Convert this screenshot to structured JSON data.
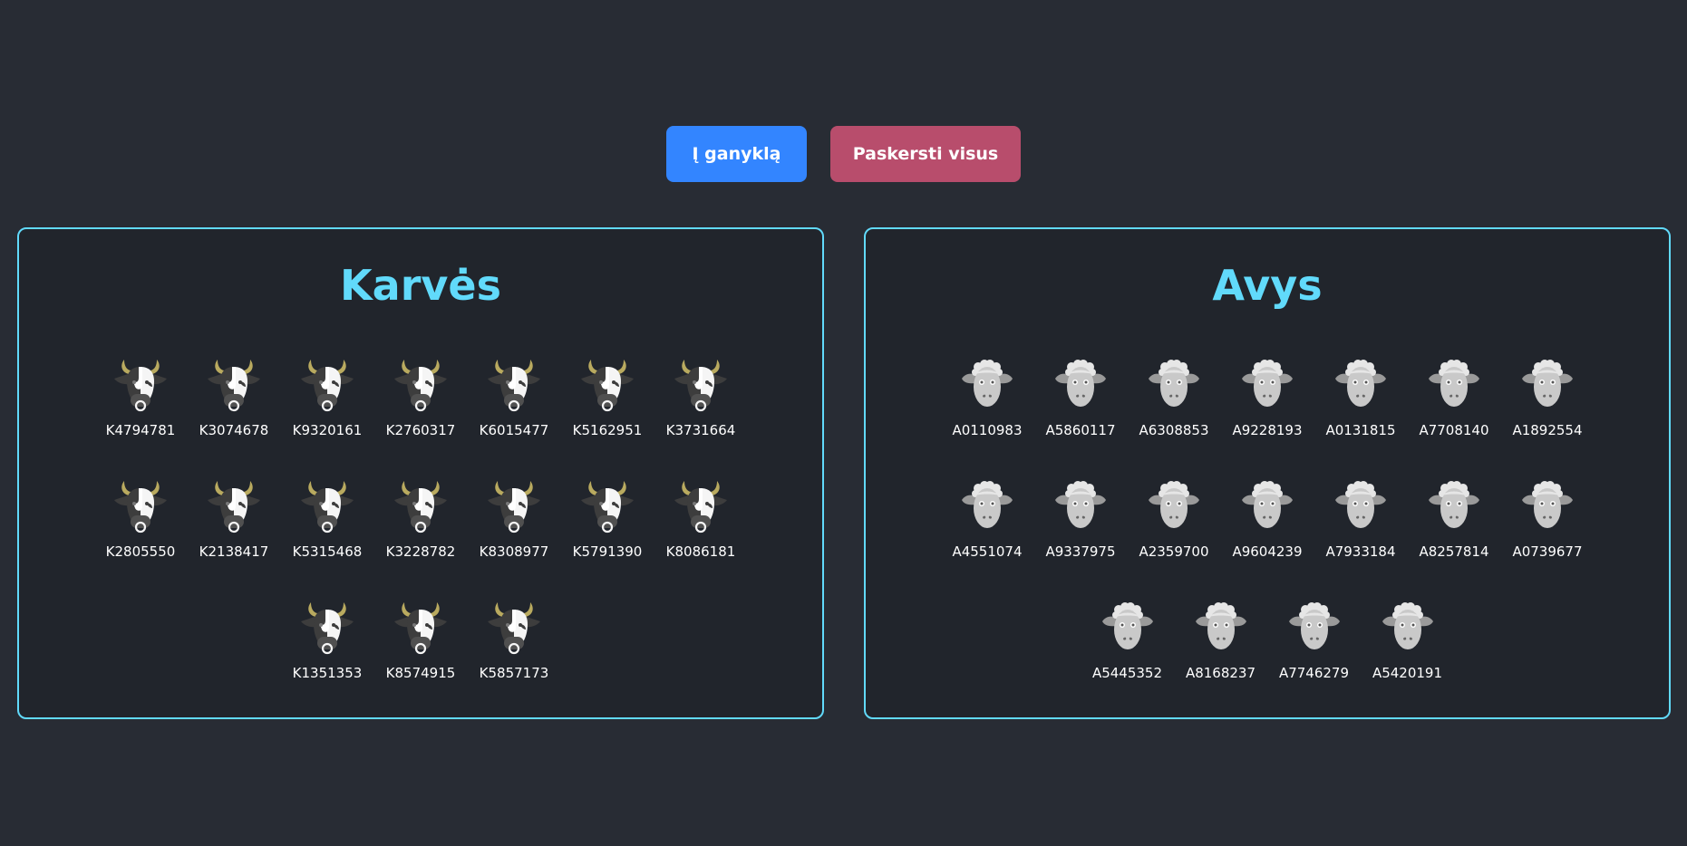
{
  "toolbar": {
    "pasture_label": "Į ganyklą",
    "slaughter_label": "Paskersti visus"
  },
  "cows": {
    "title": "Karvės",
    "icon": "cow-icon",
    "items": [
      "K4794781",
      "K3074678",
      "K9320161",
      "K2760317",
      "K6015477",
      "K5162951",
      "K3731664",
      "K2805550",
      "K2138417",
      "K5315468",
      "K3228782",
      "K8308977",
      "K5791390",
      "K8086181",
      "K1351353",
      "K8574915",
      "K5857173"
    ]
  },
  "sheep": {
    "title": "Avys",
    "icon": "sheep-icon",
    "items": [
      "A0110983",
      "A5860117",
      "A6308853",
      "A9228193",
      "A0131815",
      "A7708140",
      "A1892554",
      "A4551074",
      "A9337975",
      "A2359700",
      "A9604239",
      "A7933184",
      "A8257814",
      "A0739677",
      "A5445352",
      "A8168237",
      "A7746279",
      "A5420191"
    ]
  },
  "colors": {
    "background": "#282c34",
    "panel_border": "#61dafb",
    "title": "#61dafb",
    "pasture_button": "#3385ff",
    "slaughter_button": "#b84d6c"
  }
}
